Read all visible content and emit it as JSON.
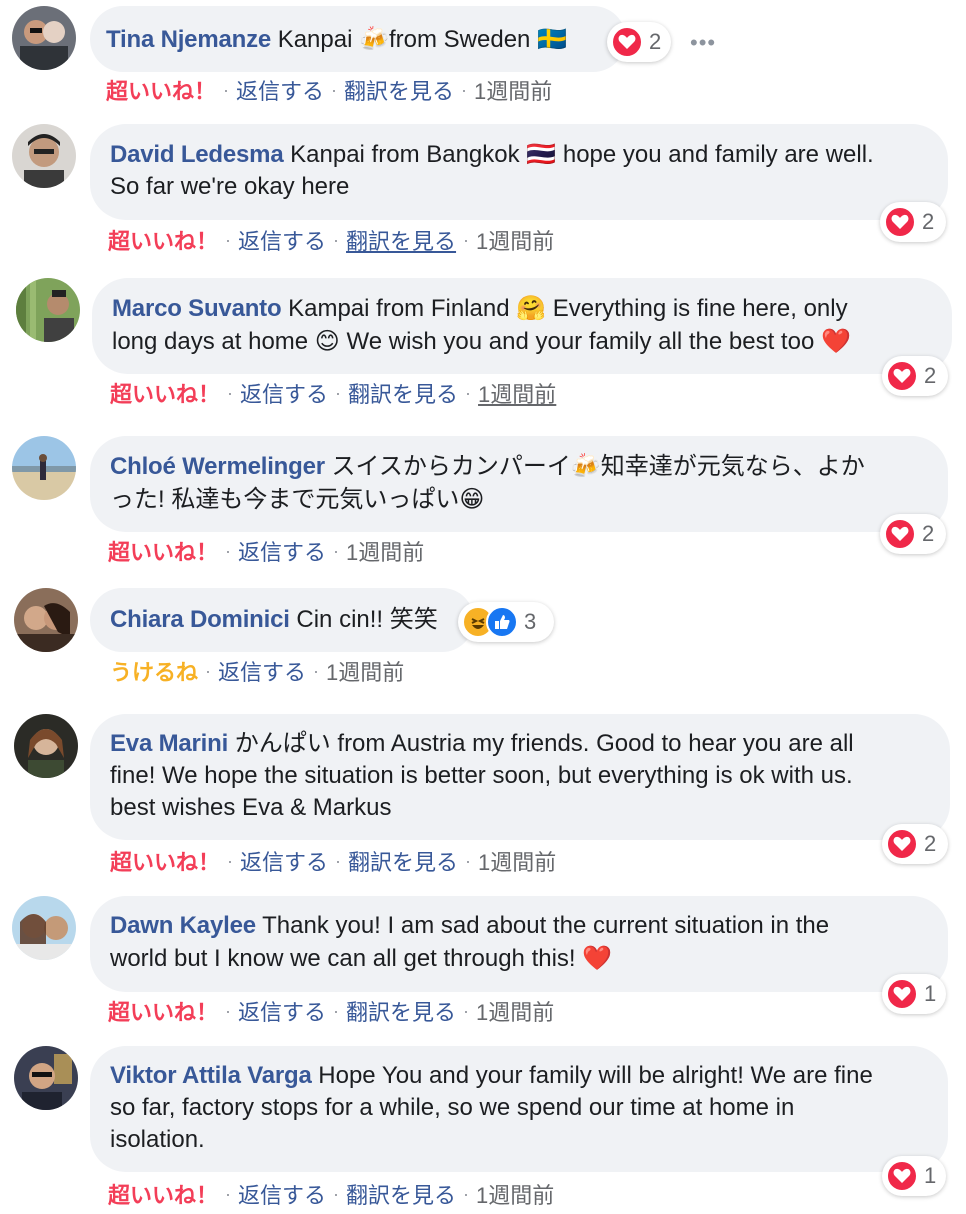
{
  "comments": [
    {
      "name": "Tina Njemanze",
      "text": "Kanpai",
      "text2": "from Sweden",
      "emoji_1": "🍻",
      "emoji_2": "🇸🇪",
      "reaction_count": "2",
      "reacted_label": "超いいね！",
      "reply_label": "返信する",
      "translate_label": "翻訳を見る",
      "time": "1週間前",
      "more_label": "•••"
    },
    {
      "name": "David Ledesma",
      "text": "Kanpai from Bangkok",
      "emoji_1": "🇹🇭",
      "text2": "hope you and family are well.",
      "line2": "So far we're okay here",
      "reaction_count": "2",
      "reacted_label": "超いいね！",
      "reply_label": "返信する",
      "translate_label": "翻訳を見る",
      "time": "1週間前"
    },
    {
      "name": "Marco Suvanto",
      "text": "Kampai from Finland",
      "emoji_1": "🤗",
      "text2": "Everything is fine here, only",
      "line2": "long days at home",
      "emoji_2": "😊",
      "line2b": "We wish you and your family all the best too",
      "emoji_3": "❤️",
      "reaction_count": "2",
      "reacted_label": "超いいね！",
      "reply_label": "返信する",
      "translate_label": "翻訳を見る",
      "time": "1週間前"
    },
    {
      "name": "Chloé Wermelinger",
      "text": "スイスからカンパーイ",
      "emoji_1": "🍻",
      "text2": "知幸達が元気なら、よか",
      "line2": "った! 私達も今まで元気いっぱい",
      "emoji_2": "😁",
      "reaction_count": "2",
      "reacted_label": "超いいね！",
      "reply_label": "返信する",
      "time": "1週間前"
    },
    {
      "name": "Chiara Dominici",
      "text": "Cin cin!! 笑笑",
      "reaction_count": "3",
      "reacted_label": "うけるね",
      "reply_label": "返信する",
      "time": "1週間前"
    },
    {
      "name": "Eva Marini",
      "text": "かんぱい from Austria my friends. Good to hear you are all",
      "line2": "fine! We hope the situation is better soon, but everything is ok with us.",
      "line3": "best wishes Eva & Markus",
      "reaction_count": "2",
      "reacted_label": "超いいね！",
      "reply_label": "返信する",
      "translate_label": "翻訳を見る",
      "time": "1週間前"
    },
    {
      "name": "Dawn Kaylee",
      "text": "Thank you! I am sad about the current situation in the",
      "line2": "world but I know we can all get through this!",
      "emoji_1": "❤️",
      "reaction_count": "1",
      "reacted_label": "超いいね！",
      "reply_label": "返信する",
      "translate_label": "翻訳を見る",
      "time": "1週間前"
    },
    {
      "name": "Viktor Attila Varga",
      "text": "Hope You and your family will be alright! We are fine",
      "line2": "so far, factory stops for a while, so we spend our time at home in",
      "line3": "isolation.",
      "reaction_count": "1",
      "reacted_label": "超いいね！",
      "reply_label": "返信する",
      "translate_label": "翻訳を見る",
      "time": "1週間前"
    }
  ],
  "separator": "·",
  "colors": {
    "name": "#385898",
    "bubble": "#f0f2f5",
    "love": "#f02849",
    "love_text": "#f33e58",
    "haha": "#f7b125",
    "like": "#1877f2",
    "meta": "#65676b"
  },
  "icons": {
    "love": "heart-icon",
    "haha": "laughing-face-icon",
    "like": "thumbs-up-icon",
    "more": "more-options-icon"
  }
}
